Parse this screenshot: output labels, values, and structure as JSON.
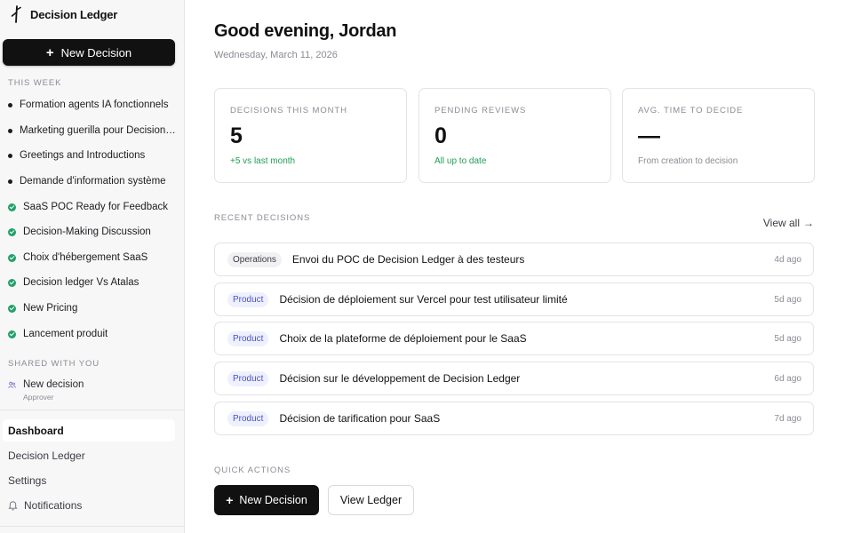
{
  "app": {
    "name": "Decision Ledger"
  },
  "sidebar": {
    "new_button": "New Decision",
    "this_week_label": "THIS WEEK",
    "this_week_items": [
      {
        "label": "Formation agents IA fonctionnels",
        "status": "in-progress"
      },
      {
        "label": "Marketing guerilla pour Decision Ledger",
        "status": "in-progress"
      },
      {
        "label": "Greetings and Introductions",
        "status": "in-progress"
      },
      {
        "label": "Demande d'information système",
        "status": "in-progress"
      },
      {
        "label": "SaaS POC Ready for Feedback",
        "status": "done"
      },
      {
        "label": "Decision-Making Discussion",
        "status": "done"
      },
      {
        "label": "Choix d'hébergement SaaS",
        "status": "done"
      },
      {
        "label": "Decision ledger Vs Atalas",
        "status": "done"
      },
      {
        "label": "New Pricing",
        "status": "done"
      },
      {
        "label": "Lancement produit",
        "status": "done"
      }
    ],
    "shared_label": "SHARED WITH YOU",
    "shared_items": [
      {
        "label": "New decision",
        "role": "Approver"
      }
    ],
    "menu": {
      "dashboard": "Dashboard",
      "ledger": "Decision Ledger",
      "settings": "Settings",
      "notifications": "Notifications"
    }
  },
  "main": {
    "greeting": "Good evening, Jordan",
    "date": "Wednesday, March 11, 2026",
    "stats": [
      {
        "label": "DECISIONS THIS MONTH",
        "value": "5",
        "sub": "+5 vs last month"
      },
      {
        "label": "PENDING REVIEWS",
        "value": "0",
        "sub": "All up to date"
      },
      {
        "label": "AVG. TIME TO DECIDE",
        "value": "—",
        "sub": "From creation to decision"
      }
    ],
    "recent_label": "RECENT DECISIONS",
    "view_all": "View all",
    "recent": [
      {
        "tag": "Operations",
        "title": "Envoi du POC de Decision Ledger à des testeurs",
        "ago": "4d ago"
      },
      {
        "tag": "Product",
        "title": "Décision de déploiement sur Vercel pour test utilisateur limité",
        "ago": "5d ago"
      },
      {
        "tag": "Product",
        "title": "Choix de la plateforme de déploiement pour le SaaS",
        "ago": "5d ago"
      },
      {
        "tag": "Product",
        "title": "Décision sur le développement de Decision Ledger",
        "ago": "6d ago"
      },
      {
        "tag": "Product",
        "title": "Décision de tarification pour SaaS",
        "ago": "7d ago"
      }
    ],
    "quick_actions_label": "QUICK ACTIONS",
    "quick_actions": {
      "new": "New Decision",
      "view": "View Ledger"
    }
  },
  "colors": {
    "primary": "#111111",
    "success": "#1f9d55",
    "product_tag": "#4a52c9"
  }
}
